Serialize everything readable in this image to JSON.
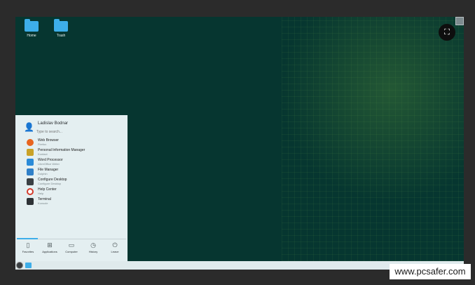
{
  "desktop": {
    "icons": [
      {
        "label": "Home",
        "icon": "folder-home-icon"
      },
      {
        "label": "Trash",
        "icon": "folder-trash-icon"
      }
    ],
    "fullscreen_icon": "⛶"
  },
  "menu": {
    "user_name": "Ladislav Bodnar",
    "search_placeholder": "Type to search...",
    "favorites": [
      {
        "title": "Web Browser",
        "subtitle": "Firefox",
        "color": "#e8651f"
      },
      {
        "title": "Personal Information Manager",
        "subtitle": "Kontact",
        "color": "#c9a227"
      },
      {
        "title": "Word Processor",
        "subtitle": "LibreOffice Writer",
        "color": "#2a8bd8"
      },
      {
        "title": "File Manager",
        "subtitle": "Dolphin",
        "color": "#2f80c8"
      },
      {
        "title": "Configure Desktop",
        "subtitle": "Configure Desktop",
        "color": "#3a4044"
      },
      {
        "title": "Help Center",
        "subtitle": "Help",
        "color": "#d33b2c"
      },
      {
        "title": "Terminal",
        "subtitle": "Konsole",
        "color": "#2e3236"
      }
    ],
    "tabs": [
      {
        "label": "Favorites",
        "icon": "▯"
      },
      {
        "label": "Applications",
        "icon": "⊞"
      },
      {
        "label": "Computer",
        "icon": "▭"
      },
      {
        "label": "History",
        "icon": "◷"
      },
      {
        "label": "Leave",
        "icon": "⏻"
      }
    ]
  },
  "watermark": "www.pcsafer.com",
  "colors": {
    "desktop_bg": "#063630",
    "accent": "#3daee9",
    "menu_bg": "#e4eff1"
  }
}
